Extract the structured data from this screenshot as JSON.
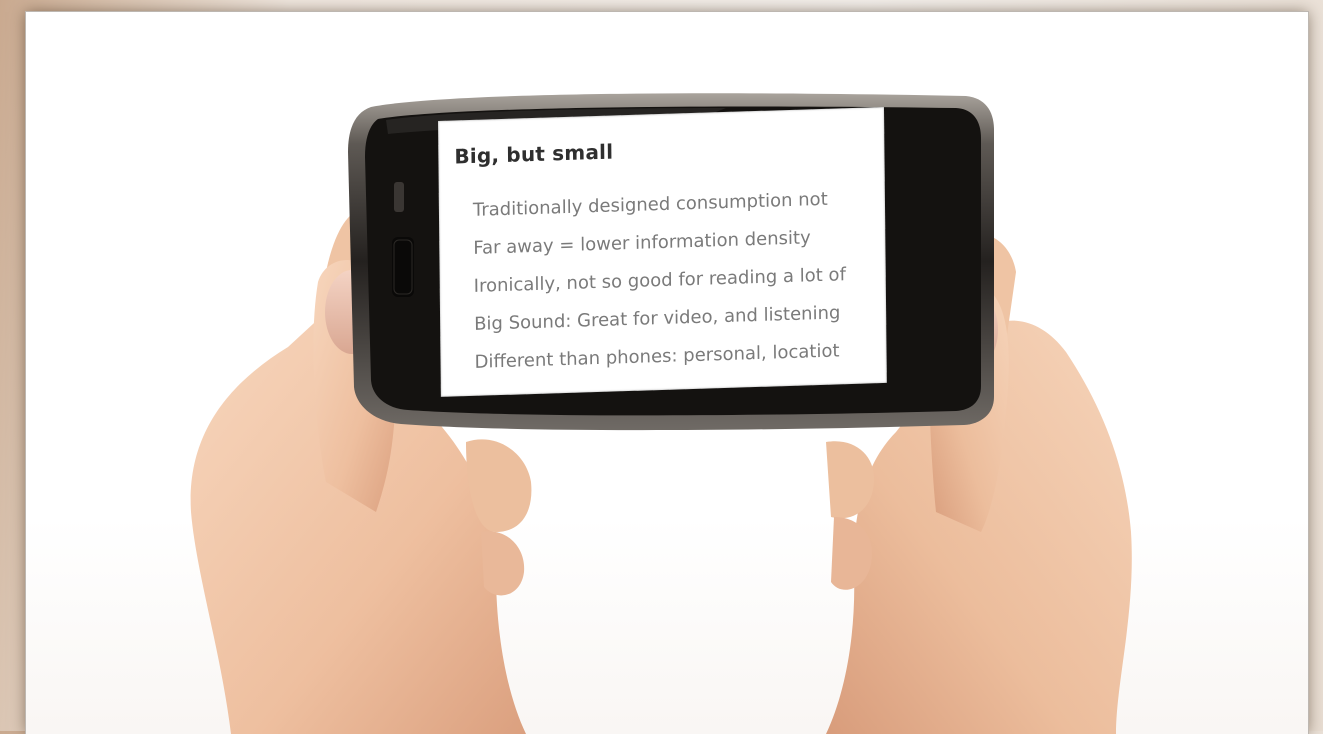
{
  "slide": {
    "title": "Big, but small",
    "bullets": [
      "Traditionally designed consumption not",
      "Far away = lower information density",
      "Ironically, not so good for reading a lot of",
      "Big Sound: Great for video, and listening",
      "Different than phones: personal, locatiot"
    ]
  },
  "colors": {
    "skin": "#f0c7a8",
    "skin_shadow": "#d79e7e",
    "phone_body": "#1c1a18",
    "phone_bezel": "#8d8883",
    "frame": "#ffffff"
  }
}
